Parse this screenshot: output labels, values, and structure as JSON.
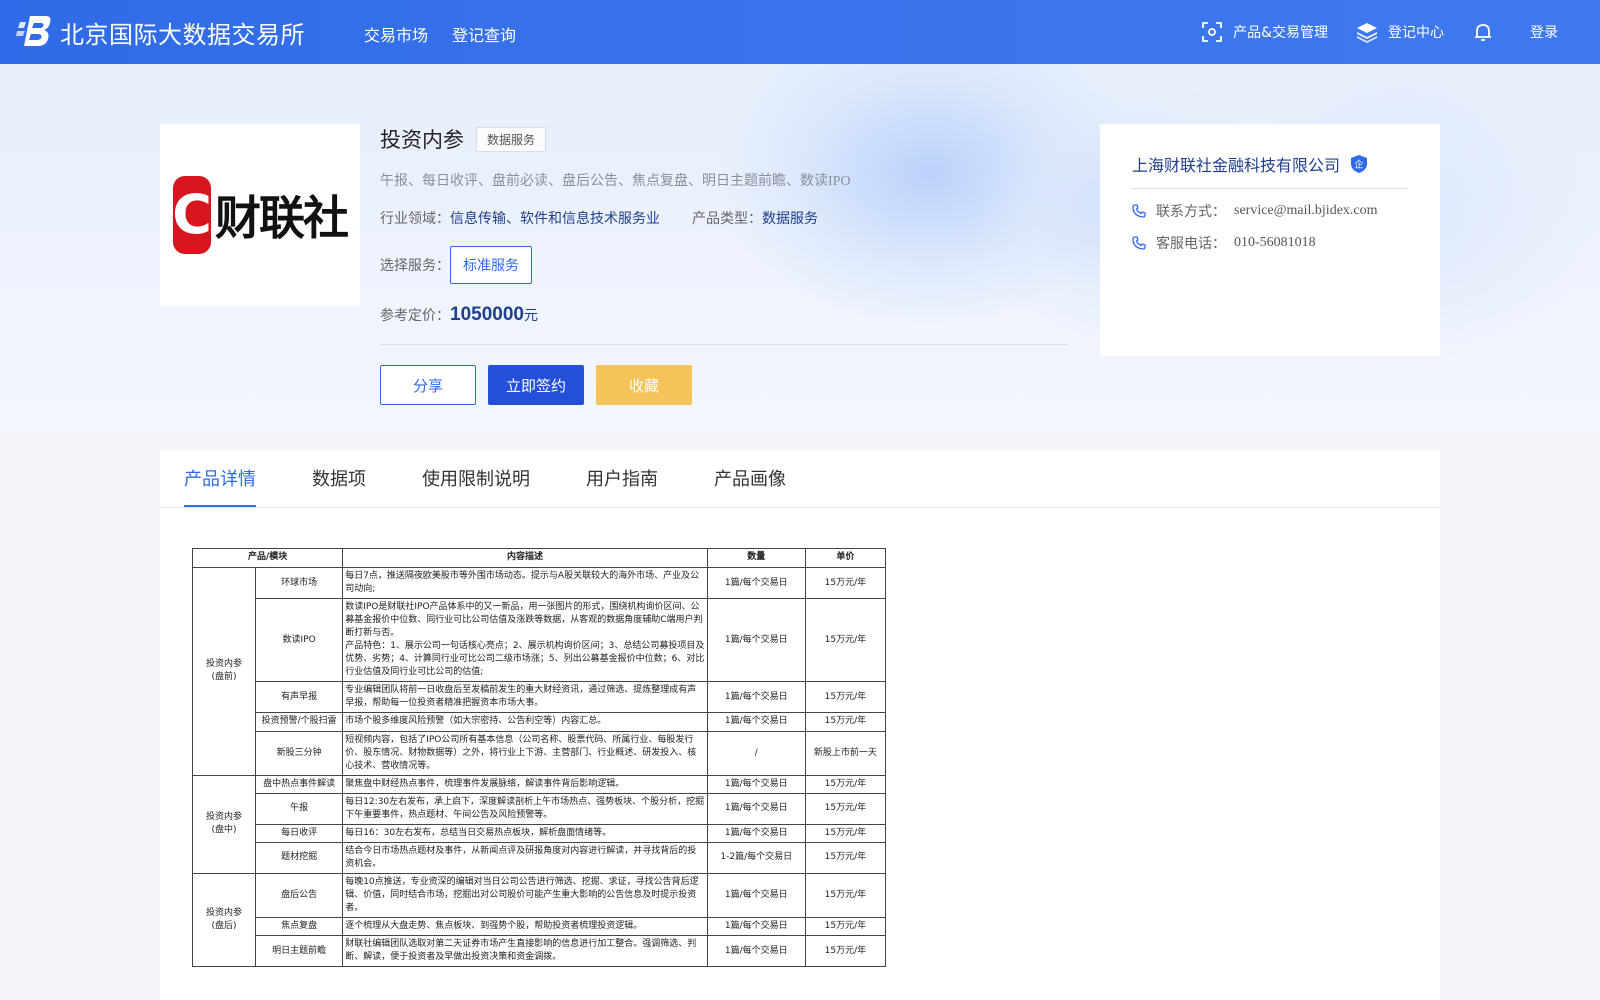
{
  "header": {
    "brand": "北京国际大数据交易所",
    "nav": [
      "交易市场",
      "登记查询"
    ],
    "product_mgmt": "产品&交易管理",
    "register_center": "登记中心",
    "login": "登录",
    "accent": "#2f6be8"
  },
  "product": {
    "logo_letter": "C",
    "logo_text": "财联社",
    "title": "投资内参",
    "tag": "数据服务",
    "desc": "午报、每日收评、盘前必读、盘后公告、焦点复盘、明日主题前瞻、数读IPO",
    "industry_label": "行业领域：",
    "industry": "信息传输、软件和信息技术服务业",
    "type_label": "产品类型：",
    "type": "数据服务",
    "service_label": "选择服务：",
    "service": "标准服务",
    "price_label": "参考定价：",
    "price": "1050000",
    "price_unit": "元",
    "btn_share": "分享",
    "btn_sign": "立即签约",
    "btn_fav": "收藏"
  },
  "company": {
    "name": "上海财联社金融科技有限公司",
    "badge": "企",
    "contact_label": "联系方式：",
    "contact": "service@mail.bjidex.com",
    "phone_label": "客服电话：",
    "phone": "010-56081018"
  },
  "tabs": [
    "产品详情",
    "数据项",
    "使用限制说明",
    "用户指南",
    "产品画像"
  ],
  "table": {
    "headers": [
      "产品/模块",
      "内容描述",
      "数量",
      "单价"
    ],
    "groups": [
      {
        "name": "投资内参\n(盘前)",
        "rows": [
          {
            "module": "环球市场",
            "desc": "每日7点，推送隔夜欧美股市等外围市场动态。提示与A股关联较大的海外市场、产业及公司动向;",
            "qty": "1篇/每个交易日",
            "price": "15万元/年"
          },
          {
            "module": "数读IPO",
            "desc": "数读IPO是财联社IPO产品体系中的又一新品，用一张图片的形式，围绕机构询价区间、公募基金报价中位数、同行业可比公司估值及涨跌等数据，从客观的数据角度辅助C端用户判断打新与否。\n产品特色：1、展示公司一句话核心亮点；2、展示机构询价区间；3、总结公司募投项目及优势、劣势；4、计算同行业可比公司二级市场涨；5、列出公募基金报价中位数；6、对比行业估值及同行业可比公司的估值;",
            "qty": "1篇/每个交易日",
            "price": "15万元/年"
          },
          {
            "module": "有声早报",
            "desc": "专业编辑团队将前一日收盘后至发稿前发生的重大财经资讯，通过筛选、提炼整理成有声早报，帮助每一位投资者精准把握资本市场大事。",
            "qty": "1篇/每个交易日",
            "price": "15万元/年"
          },
          {
            "module": "投资预警/个股扫雷",
            "desc": "市场个股多维度风险预警（如大宗密持、公告利空等）内容汇总。",
            "qty": "1篇/每个交易日",
            "price": "15万元/年"
          },
          {
            "module": "新股三分钟",
            "desc": "短视频内容，包括了IPO公司所有基本信息（公司名称、股票代码、所属行业、每股发行价、股东情况、财物数据等）之外，将行业上下游、主营部门、行业概述、研发投入、核心技术、营收情况等。",
            "qty": "/",
            "price": "新股上市前一天"
          }
        ]
      },
      {
        "name": "投资内参\n(盘中)",
        "rows": [
          {
            "module": "盘中热点事件解读",
            "desc": "聚焦盘中财经热点事件，梳理事件发展脉络，解读事件背后影响逻辑。",
            "qty": "1篇/每个交易日",
            "price": "15万元/年"
          },
          {
            "module": "午报",
            "desc": "每日12:30左右发布，承上启下，深度解读剖析上午市场热点、强势板块、个股分析，挖掘下午重要事件，热点题材、午间公告及风险预警等。",
            "qty": "1篇/每个交易日",
            "price": "15万元/年"
          },
          {
            "module": "每日收评",
            "desc": "每日16：30左右发布，总结当日交易热点板块，解析盘面情绪等。",
            "qty": "1篇/每个交易日",
            "price": "15万元/年"
          },
          {
            "module": "题材挖掘",
            "desc": "结合今日市场热点题材及事件，从新闻点评及研报角度对内容进行解读，并寻找背后的投资机会。",
            "qty": "1-2篇/每个交易日",
            "price": "15万元/年"
          }
        ]
      },
      {
        "name": "投资内参\n(盘后)",
        "rows": [
          {
            "module": "盘后公告",
            "desc": "每晚10点推送，专业资深的编辑对当日公司公告进行筛选、挖掘、求证，寻找公告背后逻辑、价值，同时结合市场，挖掘出对公司股价可能产生重大影响的公告信息及时提示投资者。",
            "qty": "1篇/每个交易日",
            "price": "15万元/年"
          },
          {
            "module": "焦点复盘",
            "desc": "逐个梳理从大盘走势、焦点板块、到强势个股，帮助投资者梳理投资逻辑。",
            "qty": "1篇/每个交易日",
            "price": "15万元/年"
          },
          {
            "module": "明日主题前瞻",
            "desc": "财联社编辑团队选取对第二天证券市场产生直接影响的信息进行加工整合。强调筛选、判断、解读，便于投资者及早做出投资决策和资金调拨。",
            "qty": "1篇/每个交易日",
            "price": "15万元/年"
          }
        ]
      }
    ]
  }
}
